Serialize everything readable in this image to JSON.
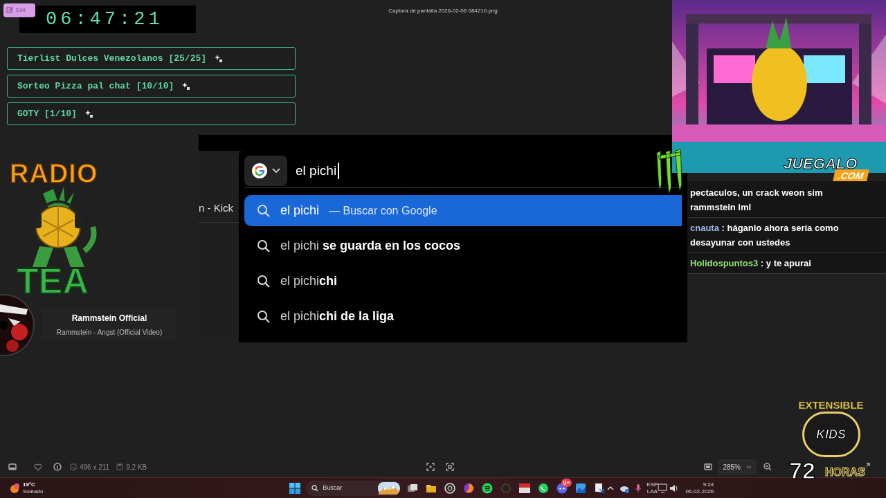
{
  "viewer": {
    "edit_button": "Edit",
    "title": "Captura de pantalla 2026-02-06 084210.png",
    "dimensions": "496 x 211",
    "file_size": "9.2 KB",
    "zoom": "285%"
  },
  "overlay": {
    "clock": "06:47:21",
    "goals": [
      {
        "label": "Tierlist Dulces Venezolanos [25/25]"
      },
      {
        "label": "Sorteo Pizza pal chat [10/10]"
      },
      {
        "label": "GOTY [1/10]"
      }
    ],
    "radio_logo": {
      "top": "RADIO",
      "bottom": "TEA"
    },
    "now_playing": {
      "channel": "Rammstein Official",
      "track": "Rammstein - Angst (Official Video)"
    },
    "sponsor_logo": {
      "name": "JUEGALO",
      "domain": ".COM"
    },
    "marathon_badge": {
      "top": "EXTENSIBLE",
      "middle": "KIDS",
      "number": "72",
      "unit": "HORAS"
    }
  },
  "browser": {
    "tab_title": "n - Kick",
    "query": "el pichi",
    "suggestions": [
      {
        "text": "el pichi",
        "hint": "— Buscar con Google",
        "selected": true
      },
      {
        "text": "el pichi **se guarda en los cocos**",
        "selected": false
      },
      {
        "text": "el pichi**chi**",
        "selected": false
      },
      {
        "text": "el pichi**chi de la liga**",
        "selected": false
      }
    ]
  },
  "chat": {
    "messages": [
      {
        "kind": "continuation",
        "lines": [
          "pectaculos, un crack weon sim",
          "rammstein lml"
        ]
      },
      {
        "kind": "message",
        "user": "cnauta",
        "color": "#9fb4e6",
        "text": ": háganlo ahora sería como desayunar con ustedes"
      },
      {
        "kind": "message",
        "user": "Holidospuntos3",
        "color": "#8de07b",
        "text": ": y te apurai"
      }
    ]
  },
  "taskbar": {
    "weather": {
      "temperature": "19°C",
      "condition": "Soleado"
    },
    "search_placeholder": "Buscar",
    "discord_badge": "9+",
    "language": "ESP",
    "layout": "LAA",
    "time": "9:24",
    "date": "06-02-2026"
  }
}
